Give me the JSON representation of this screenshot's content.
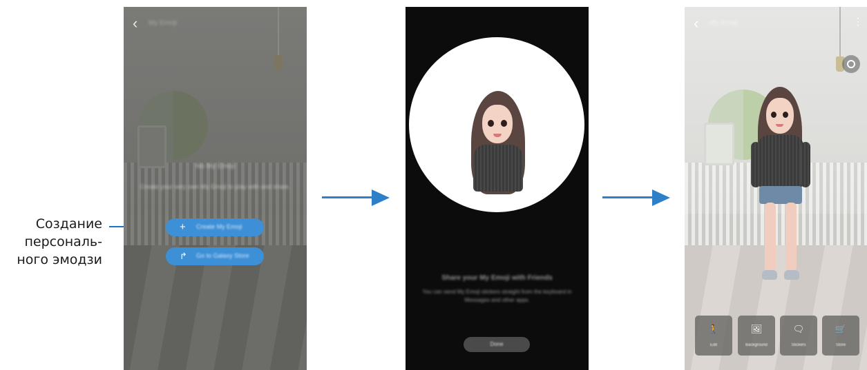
{
  "callout": {
    "lines": [
      "Создание",
      "персональ-",
      "ного эмодзи"
    ]
  },
  "screen1": {
    "title": "My Emoji",
    "heading": "No My Emoji",
    "description": "Create your very own My Emoji to play with and share.",
    "create_button": "Create My Emoji",
    "create_icon": "plus-icon",
    "goto_button": "Go to Galaxy Store",
    "goto_icon": "share-arrow-icon"
  },
  "screen2": {
    "heading": "Share your My Emoji with Friends",
    "description": "You can send My Emoji stickers straight from the keyboard in Messages and other apps.",
    "done_button": "Done"
  },
  "screen3": {
    "title": "My Emoji",
    "tools": [
      {
        "label": "Edit",
        "icon": "person-icon",
        "glyph": "🚶"
      },
      {
        "label": "Background",
        "icon": "image-icon",
        "glyph": "🖼"
      },
      {
        "label": "Stickers",
        "icon": "sticker-icon",
        "glyph": "🗨"
      },
      {
        "label": "Store",
        "icon": "cart-icon",
        "glyph": "🛒"
      }
    ]
  },
  "colors": {
    "accent": "#2d7fc8",
    "button": "#3d8fd6"
  }
}
